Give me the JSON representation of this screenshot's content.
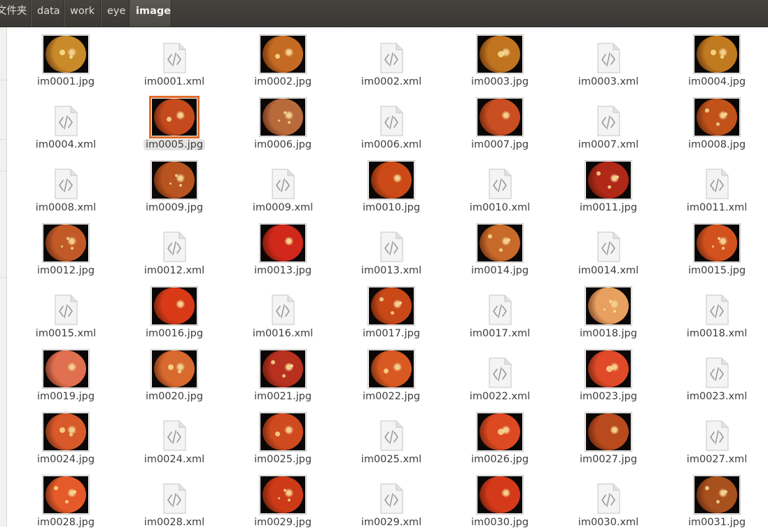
{
  "breadcrumb": [
    {
      "label": "文件夹",
      "active": false
    },
    {
      "label": "data",
      "active": false
    },
    {
      "label": "work",
      "active": false
    },
    {
      "label": "eye",
      "active": false
    },
    {
      "label": "image",
      "active": true
    }
  ],
  "files": [
    {
      "name": "im0001.jpg",
      "type": "image",
      "tone": "#c98a2a"
    },
    {
      "name": "im0001.xml",
      "type": "xml"
    },
    {
      "name": "im0002.jpg",
      "type": "image",
      "tone": "#c46a22"
    },
    {
      "name": "im0002.xml",
      "type": "xml"
    },
    {
      "name": "im0003.jpg",
      "type": "image",
      "tone": "#c0741f"
    },
    {
      "name": "im0003.xml",
      "type": "xml"
    },
    {
      "name": "im0004.jpg",
      "type": "image",
      "tone": "#c07a1f"
    },
    {
      "name": "im0004.xml",
      "type": "xml"
    },
    {
      "name": "im0005.jpg",
      "type": "image",
      "tone": "#c54a1e",
      "selected": true
    },
    {
      "name": "im0006.jpg",
      "type": "image",
      "tone": "#b96a3b"
    },
    {
      "name": "im0006.xml",
      "type": "xml"
    },
    {
      "name": "im0007.jpg",
      "type": "image",
      "tone": "#c94e22"
    },
    {
      "name": "im0007.xml",
      "type": "xml"
    },
    {
      "name": "im0008.jpg",
      "type": "image",
      "tone": "#c0521a"
    },
    {
      "name": "im0008.xml",
      "type": "xml"
    },
    {
      "name": "im0009.jpg",
      "type": "image",
      "tone": "#b8541f"
    },
    {
      "name": "im0009.xml",
      "type": "xml"
    },
    {
      "name": "im0010.jpg",
      "type": "image",
      "tone": "#cc4a18"
    },
    {
      "name": "im0010.xml",
      "type": "xml"
    },
    {
      "name": "im0011.jpg",
      "type": "image",
      "tone": "#b02818"
    },
    {
      "name": "im0011.xml",
      "type": "xml"
    },
    {
      "name": "im0012.jpg",
      "type": "image",
      "tone": "#c25a28"
    },
    {
      "name": "im0012.xml",
      "type": "xml"
    },
    {
      "name": "im0013.jpg",
      "type": "image",
      "tone": "#d0281a"
    },
    {
      "name": "im0013.xml",
      "type": "xml"
    },
    {
      "name": "im0014.jpg",
      "type": "image",
      "tone": "#c86a2a"
    },
    {
      "name": "im0014.xml",
      "type": "xml"
    },
    {
      "name": "im0015.jpg",
      "type": "image",
      "tone": "#d2521e"
    },
    {
      "name": "im0015.xml",
      "type": "xml"
    },
    {
      "name": "im0016.jpg",
      "type": "image",
      "tone": "#d83a18"
    },
    {
      "name": "im0016.xml",
      "type": "xml"
    },
    {
      "name": "im0017.jpg",
      "type": "image",
      "tone": "#c84818"
    },
    {
      "name": "im0017.xml",
      "type": "xml"
    },
    {
      "name": "im0018.jpg",
      "type": "image",
      "tone": "#e8a060"
    },
    {
      "name": "im0018.xml",
      "type": "xml"
    },
    {
      "name": "im0019.jpg",
      "type": "image",
      "tone": "#e07050"
    },
    {
      "name": "im0020.jpg",
      "type": "image",
      "tone": "#d86a30"
    },
    {
      "name": "im0021.jpg",
      "type": "image",
      "tone": "#b8301e"
    },
    {
      "name": "im0022.jpg",
      "type": "image",
      "tone": "#d85a22"
    },
    {
      "name": "im0022.xml",
      "type": "xml"
    },
    {
      "name": "im0023.jpg",
      "type": "image",
      "tone": "#e04a28"
    },
    {
      "name": "im0023.xml",
      "type": "xml"
    },
    {
      "name": "im0024.jpg",
      "type": "image",
      "tone": "#d85a2a"
    },
    {
      "name": "im0024.xml",
      "type": "xml"
    },
    {
      "name": "im0025.jpg",
      "type": "image",
      "tone": "#d04a20"
    },
    {
      "name": "im0025.xml",
      "type": "xml"
    },
    {
      "name": "im0026.jpg",
      "type": "image",
      "tone": "#dd4a22"
    },
    {
      "name": "im0027.jpg",
      "type": "image",
      "tone": "#b84a1e"
    },
    {
      "name": "im0027.xml",
      "type": "xml"
    },
    {
      "name": "im0028.jpg",
      "type": "image",
      "tone": "#e45a28"
    },
    {
      "name": "im0028.xml",
      "type": "xml"
    },
    {
      "name": "im0029.jpg",
      "type": "image",
      "tone": "#cc3a18"
    },
    {
      "name": "im0029.xml",
      "type": "xml"
    },
    {
      "name": "im0030.jpg",
      "type": "image",
      "tone": "#d43a1a"
    },
    {
      "name": "im0030.xml",
      "type": "xml"
    },
    {
      "name": "im0031.jpg",
      "type": "image",
      "tone": "#a8501e"
    }
  ]
}
